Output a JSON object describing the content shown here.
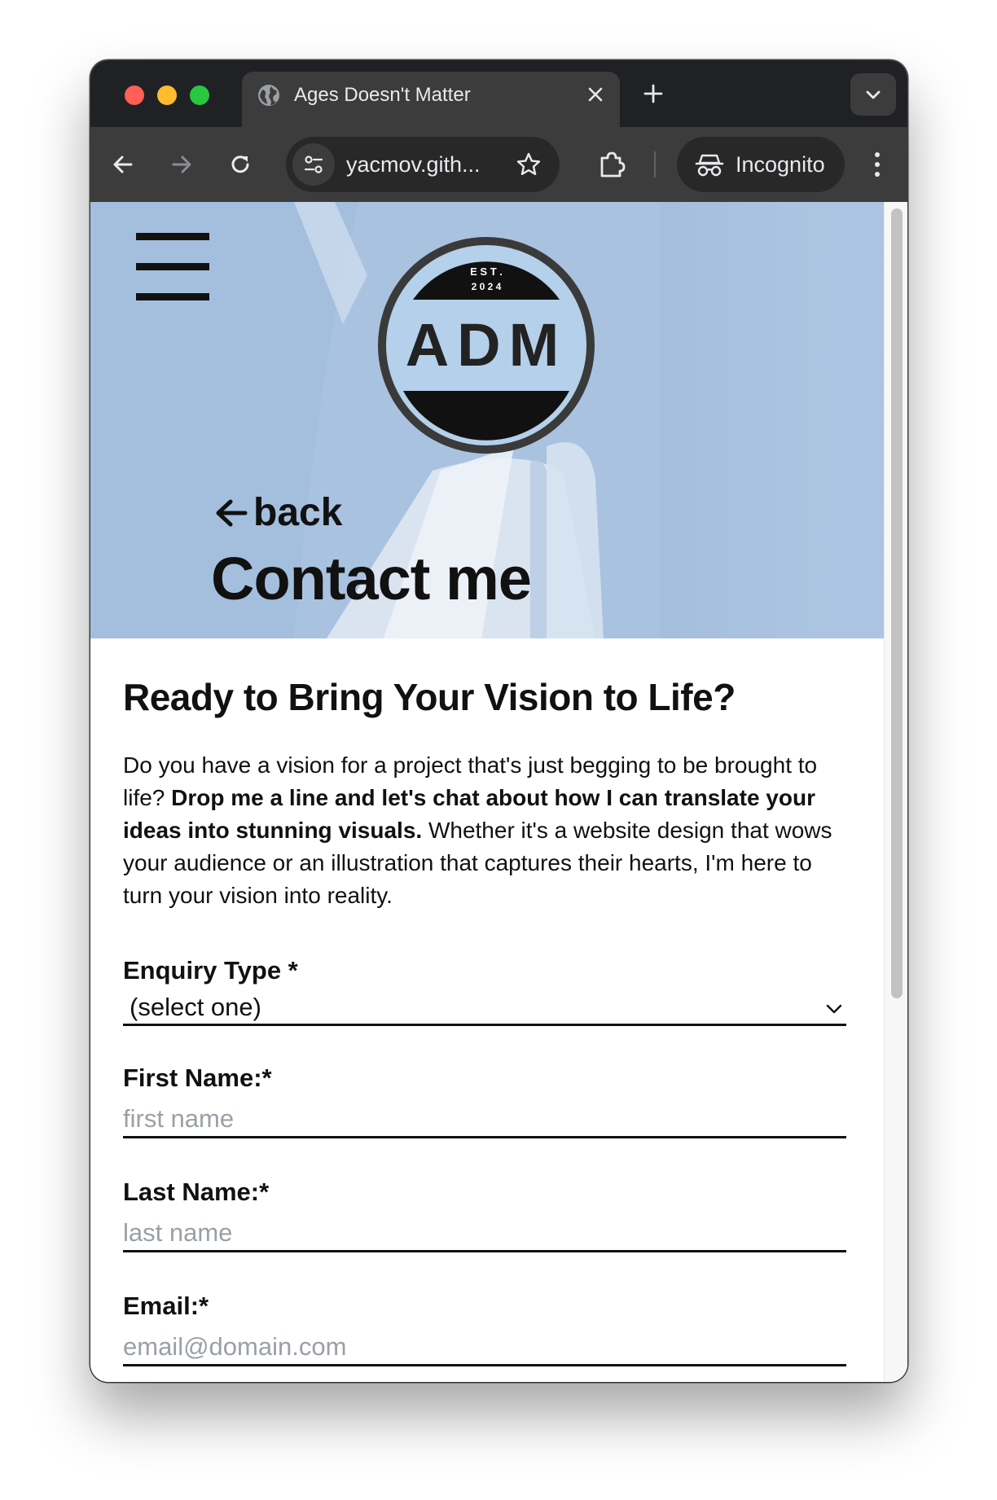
{
  "browser": {
    "tab_title": "Ages Doesn't Matter",
    "url": "yacmov.gith...",
    "incognito_label": "Incognito"
  },
  "logo": {
    "est_line1": "E S T .",
    "est_line2": "2 0 2 4",
    "initials": "ADM"
  },
  "hero": {
    "back_label": "back",
    "title": "Contact me"
  },
  "content": {
    "heading": "Ready to Bring Your Vision to Life?",
    "intro_part1": "Do you have a vision for a project that's just begging to be brought to life? ",
    "intro_bold": "Drop me a line and let's chat about how I can translate your ideas into stunning visuals.",
    "intro_part2": " Whether it's a website design that wows your audience or an illustration that captures their hearts, I'm here to turn your vision into reality."
  },
  "form": {
    "enquiry_label": "Enquiry Type *",
    "enquiry_value": "(select one)",
    "first_name_label": "First Name:*",
    "first_name_placeholder": "first name",
    "last_name_label": "Last Name:*",
    "last_name_placeholder": "last name",
    "email_label": "Email:*",
    "email_placeholder": "email@domain.com"
  },
  "colors": {
    "hero_bg": "#a9c3e1",
    "logo_ring": "#3a3a3a",
    "chrome_dark": "#202124",
    "chrome_toolbar": "#3c3c3c"
  }
}
